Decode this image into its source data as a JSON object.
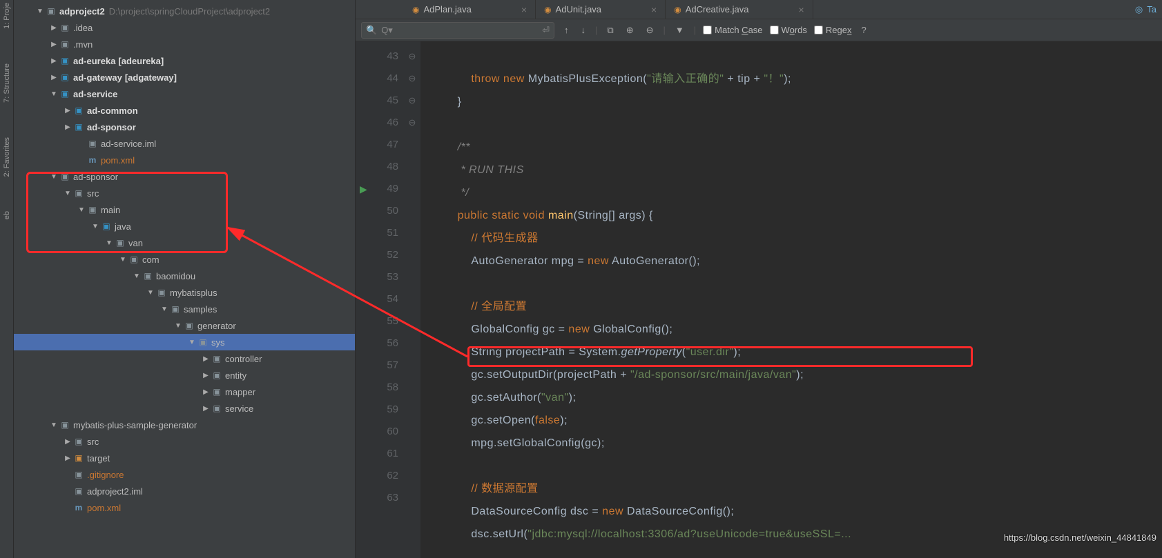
{
  "ltool": {
    "proj": "1: Proje",
    "struct": "7: Structure",
    "fav": "2: Favorites",
    "eb": "eb"
  },
  "tree": [
    {
      "ind": 30,
      "arr": "▼",
      "ic": "ic-mod",
      "bold": 1,
      "label": "adproject2",
      "loc": "D:\\project\\springCloudProject\\adproject2"
    },
    {
      "ind": 50,
      "arr": "▶",
      "ic": "ic-folder",
      "label": ".idea"
    },
    {
      "ind": 50,
      "arr": "▶",
      "ic": "ic-folder",
      "label": ".mvn"
    },
    {
      "ind": 50,
      "arr": "▶",
      "ic": "ic-blue",
      "label": "ad-eureka",
      "bold": 1,
      "suffix": "[adeureka]"
    },
    {
      "ind": 50,
      "arr": "▶",
      "ic": "ic-blue",
      "label": "ad-gateway",
      "bold": 1,
      "suffix": "[adgateway]"
    },
    {
      "ind": 50,
      "arr": "▼",
      "ic": "ic-blue",
      "bold": 1,
      "label": "ad-service"
    },
    {
      "ind": 70,
      "arr": "▶",
      "ic": "ic-blue",
      "bold": 1,
      "label": "ad-common"
    },
    {
      "ind": 70,
      "arr": "▶",
      "ic": "ic-blue",
      "bold": 1,
      "label": "ad-sponsor"
    },
    {
      "ind": 90,
      "arr": "",
      "ic": "ic-folder",
      "label": "ad-service.iml"
    },
    {
      "ind": 90,
      "arr": "",
      "ic": "ic-m",
      "icl": "m",
      "label": "pom.xml",
      "orange": 1
    },
    {
      "ind": 50,
      "arr": "▼",
      "ic": "ic-folder",
      "label": "ad-sponsor"
    },
    {
      "ind": 70,
      "arr": "▼",
      "ic": "ic-folder",
      "label": "src"
    },
    {
      "ind": 90,
      "arr": "▼",
      "ic": "ic-folder",
      "label": "main"
    },
    {
      "ind": 110,
      "arr": "▼",
      "ic": "ic-blue",
      "label": "java"
    },
    {
      "ind": 130,
      "arr": "▼",
      "ic": "ic-folder",
      "label": "van"
    },
    {
      "ind": 150,
      "arr": "▼",
      "ic": "ic-folder",
      "label": "com"
    },
    {
      "ind": 170,
      "arr": "▼",
      "ic": "ic-folder",
      "label": "baomidou"
    },
    {
      "ind": 190,
      "arr": "▼",
      "ic": "ic-folder",
      "label": "mybatisplus"
    },
    {
      "ind": 210,
      "arr": "▼",
      "ic": "ic-folder",
      "label": "samples"
    },
    {
      "ind": 230,
      "arr": "▼",
      "ic": "ic-folder",
      "label": "generator"
    },
    {
      "ind": 250,
      "arr": "▼",
      "ic": "ic-folder",
      "label": "sys",
      "sel": 1
    },
    {
      "ind": 270,
      "arr": "▶",
      "ic": "ic-folder",
      "label": "controller"
    },
    {
      "ind": 270,
      "arr": "▶",
      "ic": "ic-folder",
      "label": "entity"
    },
    {
      "ind": 270,
      "arr": "▶",
      "ic": "ic-folder",
      "label": "mapper"
    },
    {
      "ind": 270,
      "arr": "▶",
      "ic": "ic-folder",
      "label": "service"
    },
    {
      "ind": 50,
      "arr": "▼",
      "ic": "ic-folder",
      "label": "mybatis-plus-sample-generator"
    },
    {
      "ind": 70,
      "arr": "▶",
      "ic": "ic-folder",
      "label": "src"
    },
    {
      "ind": 70,
      "arr": "▶",
      "ic": "ic-orange",
      "label": "target"
    },
    {
      "ind": 70,
      "arr": "",
      "ic": "ic-folder",
      "label": ".gitignore",
      "orange": 1
    },
    {
      "ind": 70,
      "arr": "",
      "ic": "ic-folder",
      "label": "adproject2.iml"
    },
    {
      "ind": 70,
      "arr": "",
      "ic": "ic-m",
      "icl": "m",
      "label": "pom.xml",
      "orange": 1
    }
  ],
  "tabs": [
    {
      "label": "AdPlan.java"
    },
    {
      "label": "AdUnit.java"
    },
    {
      "label": "AdCreative.java"
    }
  ],
  "rtool": {
    "label": "Ta"
  },
  "search": {
    "placeholder": "Q▾",
    "matchcase": "Match Case",
    "words": "Words",
    "regex": "Regex",
    "q": "?"
  },
  "gutter": [
    "43",
    "44",
    "45",
    "46",
    "47",
    "48",
    "49",
    "50",
    "51",
    "52",
    "53",
    "54",
    "55",
    "56",
    "57",
    "58",
    "59",
    "60",
    "61",
    "62",
    "63"
  ],
  "runline": "49",
  "code": {
    "l43a": "throw",
    "l43b": "new",
    "l43c": "MybatisPlusException(",
    "l43d": "\"请输入正确的\"",
    "l43e": " + tip + ",
    "l43f": "\"！\"",
    "l43g": ");",
    "l44": "        }",
    "l46": "        /**",
    "l47": "         * RUN THIS",
    "l48": "         */",
    "l49a": "public",
    "l49b": "static",
    "l49c": "void",
    "l49d": "main",
    "l49e": "(String[] args) {",
    "l50": "// 代码生成器",
    "l51a": "AutoGenerator mpg = ",
    "l51b": "new",
    "l51c": " AutoGenerator();",
    "l53": "// 全局配置",
    "l54a": "GlobalConfig gc = ",
    "l54b": "new",
    "l54c": " GlobalConfig();",
    "l55a": "String projectPath = System.",
    "l55b": "getProperty",
    "l55c": "(",
    "l55d": "\"user.dir\"",
    "l55e": ");",
    "l56a": "gc.setOutputDir(projectPath + ",
    "l56b": "\"/ad-sponsor/src/main/java/van\"",
    "l56c": ");",
    "l57a": "gc.setAuthor(",
    "l57b": "\"van\"",
    "l57c": ");",
    "l58a": "gc.setOpen(",
    "l58b": "false",
    "l58c": ");",
    "l59": "mpg.setGlobalConfig(gc);",
    "l61": "// 数据源配置",
    "l62a": "DataSourceConfig dsc = ",
    "l62b": "new",
    "l62c": " DataSourceConfig();",
    "l63a": "dsc.setUrl(",
    "l63b": "\"jdbc:mysql://localhost:3306/ad?useUnicode=true&useSSL=..."
  },
  "watermark": "https://blog.csdn.net/weixin_44841849"
}
